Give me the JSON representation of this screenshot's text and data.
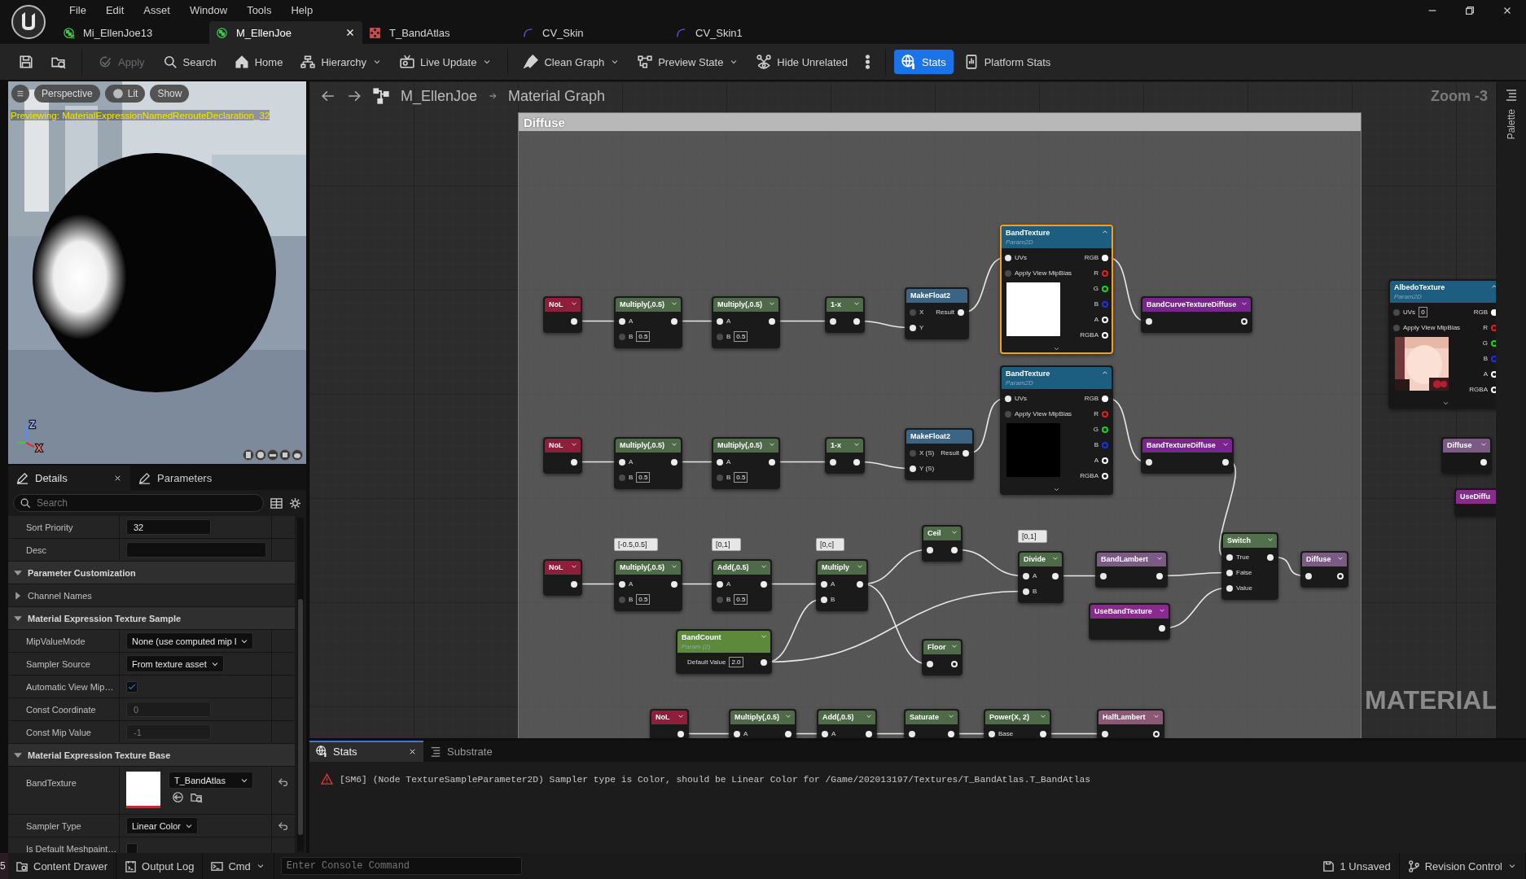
{
  "window": {
    "menu": [
      "File",
      "Edit",
      "Asset",
      "Window",
      "Tools",
      "Help"
    ],
    "tabs": [
      {
        "label": "Mi_EllenJoe13",
        "selected": false,
        "closable": false
      },
      {
        "label": "M_EllenJoe",
        "selected": true,
        "closable": true
      },
      {
        "label": "T_BandAtlas",
        "selected": false,
        "closable": false
      },
      {
        "label": "CV_Skin",
        "selected": false,
        "closable": false
      },
      {
        "label": "CV_Skin1",
        "selected": false,
        "closable": false
      }
    ]
  },
  "toolbar": [
    {
      "kind": "button",
      "disabled": false,
      "dropdown": false,
      "active": false
    },
    {
      "kind": "button",
      "disabled": false,
      "dropdown": false,
      "active": false
    },
    {
      "kind": "separator"
    },
    {
      "kind": "button",
      "label": "Apply",
      "disabled": true,
      "dropdown": false,
      "active": false
    },
    {
      "kind": "button",
      "label": "Search",
      "disabled": false,
      "dropdown": false,
      "active": false
    },
    {
      "kind": "button",
      "label": "Home",
      "disabled": false,
      "dropdown": false,
      "active": false
    },
    {
      "kind": "button",
      "label": "Hierarchy",
      "disabled": false,
      "dropdown": true,
      "active": false
    },
    {
      "kind": "button",
      "label": "Live Update",
      "disabled": false,
      "dropdown": true,
      "active": false
    },
    {
      "kind": "separator"
    },
    {
      "kind": "button",
      "label": "Clean Graph",
      "disabled": false,
      "dropdown": true,
      "active": false
    },
    {
      "kind": "button",
      "label": "Preview State",
      "disabled": false,
      "dropdown": true,
      "active": false
    },
    {
      "kind": "button",
      "label": "Hide Unrelated",
      "disabled": false,
      "dropdown": false,
      "active": false
    },
    {
      "kind": "button",
      "disabled": false,
      "dropdown": false,
      "active": false
    },
    {
      "kind": "separator"
    },
    {
      "kind": "button",
      "label": "Stats",
      "disabled": false,
      "dropdown": false,
      "active": true
    },
    {
      "kind": "button",
      "label": "Platform Stats",
      "disabled": false,
      "dropdown": false,
      "active": false
    }
  ],
  "viewport": {
    "buttons": [
      {
        "kind": "menu"
      },
      {
        "kind": "pill",
        "label": "Perspective"
      },
      {
        "kind": "lit",
        "label": "Lit"
      },
      {
        "kind": "pill",
        "label": "Show"
      }
    ],
    "preview_text": "Previewing: MaterialExpressionNamedRerouteDeclaration_32",
    "axes": [
      "Z",
      "X"
    ]
  },
  "details": {
    "tabs": [
      {
        "label": "Details",
        "selected": true,
        "closable": true
      },
      {
        "label": "Parameters",
        "selected": false,
        "closable": false
      }
    ],
    "search": {
      "placeholder": "Search"
    },
    "rows": [
      {
        "kind": "text",
        "label": "Sort Priority",
        "value": "32",
        "disabled": false
      },
      {
        "kind": "textarea",
        "label": "Desc",
        "disabled": false
      },
      {
        "kind": "section",
        "label": "Parameter Customization",
        "expanded": true
      },
      {
        "kind": "group",
        "label": "Channel Names",
        "expanded": false
      },
      {
        "kind": "section",
        "label": "Material Expression Texture Sample",
        "expanded": true
      },
      {
        "kind": "dropdown",
        "label": "MipValueMode",
        "value": "None (use computed mip l",
        "reset": false
      },
      {
        "kind": "dropdown",
        "label": "Sampler Source",
        "value": "From texture asset",
        "reset": false
      },
      {
        "kind": "checkbox",
        "label": "Automatic View Mip…",
        "checked": true
      },
      {
        "kind": "text",
        "label": "Const Coordinate",
        "value": "0",
        "disabled": true
      },
      {
        "kind": "text",
        "label": "Const Mip Value",
        "value": "-1",
        "disabled": true
      },
      {
        "kind": "section",
        "label": "Material Expression Texture Base",
        "expanded": true
      },
      {
        "kind": "asset",
        "label": "BandTexture",
        "value": "T_BandAtlas",
        "reset": true
      },
      {
        "kind": "dropdown",
        "label": "Sampler Type",
        "value": "Linear Color",
        "reset": true
      },
      {
        "kind": "checkbox",
        "label": "Is Default Meshpaint…",
        "checked": false
      }
    ]
  },
  "graph": {
    "breadcrumb": [
      "M_EllenJoe",
      "Material Graph"
    ],
    "zoom": "Zoom -3",
    "palette": "Palette",
    "watermark": "MATERIAL",
    "comment": {
      "title": "Diffuse"
    },
    "nodes": [
      {
        "kind": "reroute",
        "title": "NoL",
        "color": "#8e1f3b",
        "selected": false,
        "outputs": [
          {
            "connected": true
          }
        ]
      },
      {
        "kind": "math",
        "title": "Multiply(,0.5)",
        "color": "#4e6a48",
        "selected": false,
        "inputs": [
          {
            "label": "A",
            "connected": true
          },
          {
            "label": "B",
            "value": "0.5",
            "connected": false
          }
        ],
        "outputs": [
          {
            "connected": true
          }
        ]
      },
      {
        "kind": "math",
        "title": "Multiply(,0.5)",
        "color": "#4e6a48",
        "selected": false,
        "inputs": [
          {
            "label": "A",
            "connected": true
          },
          {
            "label": "B",
            "value": "0.5",
            "connected": false
          }
        ],
        "outputs": [
          {
            "connected": true
          }
        ]
      },
      {
        "kind": "math",
        "title": "1-x",
        "color": "#4e6a48",
        "selected": false,
        "inputs": [
          {
            "connected": true
          }
        ],
        "outputs": [
          {
            "connected": true
          }
        ]
      },
      {
        "kind": "make",
        "title": "MakeFloat2",
        "color": "#3c6585",
        "selected": false,
        "inputs": [
          {
            "label": "X",
            "connected": false
          },
          {
            "label": "Y",
            "connected": true
          }
        ],
        "outputs": [
          {
            "label": "Result",
            "connected": true
          }
        ]
      },
      {
        "kind": "texture",
        "title": "BandTexture",
        "subtitle": "Param2D",
        "color": "#1c5d80",
        "selected": true,
        "preview": {
          "kind": "swatch",
          "color": "#ffffff"
        },
        "inputs": [
          {
            "label": "UVs",
            "connected": true
          },
          {
            "label": "Apply View MipBias",
            "connected": false
          }
        ],
        "outputs": [
          {
            "label": "RGB",
            "connected": true,
            "color": "#ffffff"
          },
          {
            "label": "R",
            "connected": false,
            "color": "#e02020"
          },
          {
            "label": "G",
            "connected": false,
            "color": "#20d020"
          },
          {
            "label": "B",
            "connected": false,
            "color": "#2030e0"
          },
          {
            "label": "A",
            "connected": false,
            "color": "#ffffff"
          },
          {
            "label": "RGBA",
            "connected": false,
            "color": "#ffffff"
          }
        ]
      },
      {
        "kind": "reroute",
        "title": "BandCurveTextureDiffuse",
        "color": "#7a2490",
        "selected": false,
        "inputs": [
          {
            "connected": true
          }
        ],
        "outputs": [
          {
            "connected": false
          }
        ]
      },
      {
        "kind": "texture",
        "title": "AlbedoTexture",
        "subtitle": "Param2D",
        "color": "#1c5d80",
        "selected": false,
        "preview": {
          "kind": "picture"
        },
        "inputs": [
          {
            "label": "UVs",
            "value": "0",
            "connected": false
          },
          {
            "label": "Apply View MipBias",
            "connected": false
          }
        ],
        "outputs": [
          {
            "label": "RGB",
            "connected": true,
            "color": "#ffffff"
          },
          {
            "label": "R",
            "connected": false,
            "color": "#e02020"
          },
          {
            "label": "G",
            "connected": false,
            "color": "#20d020"
          },
          {
            "label": "B",
            "connected": false,
            "color": "#2030e0"
          },
          {
            "label": "A",
            "connected": false,
            "color": "#ffffff"
          },
          {
            "label": "RGBA",
            "connected": false,
            "color": "#ffffff"
          }
        ]
      },
      {
        "kind": "reroute",
        "title": "NoL",
        "color": "#8e1f3b",
        "selected": false,
        "outputs": [
          {
            "connected": true
          }
        ]
      },
      {
        "kind": "math",
        "title": "Multiply(,0.5)",
        "color": "#4e6a48",
        "selected": false,
        "inputs": [
          {
            "label": "A",
            "connected": true
          },
          {
            "label": "B",
            "value": "0.5",
            "connected": false
          }
        ],
        "outputs": [
          {
            "connected": true
          }
        ]
      },
      {
        "kind": "math",
        "title": "Multiply(,0.5)",
        "color": "#4e6a48",
        "selected": false,
        "inputs": [
          {
            "label": "A",
            "connected": true
          },
          {
            "label": "B",
            "value": "0.5",
            "connected": false
          }
        ],
        "outputs": [
          {
            "connected": true
          }
        ]
      },
      {
        "kind": "math",
        "title": "1-x",
        "color": "#4e6a48",
        "selected": false,
        "inputs": [
          {
            "connected": true
          }
        ],
        "outputs": [
          {
            "connected": true
          }
        ]
      },
      {
        "kind": "make",
        "title": "MakeFloat2",
        "color": "#3c6585",
        "selected": false,
        "inputs": [
          {
            "label": "X (S)",
            "connected": false
          },
          {
            "label": "Y (S)",
            "connected": true
          }
        ],
        "outputs": [
          {
            "label": "Result",
            "connected": true
          }
        ]
      },
      {
        "kind": "texture",
        "title": "BandTexture",
        "subtitle": "Param2D",
        "color": "#1c5d80",
        "selected": false,
        "preview": {
          "kind": "swatch",
          "color": "#000000"
        },
        "inputs": [
          {
            "label": "UVs",
            "connected": true
          },
          {
            "label": "Apply View MipBias",
            "connected": false
          }
        ],
        "outputs": [
          {
            "label": "RGB",
            "connected": true,
            "color": "#ffffff"
          },
          {
            "label": "R",
            "connected": false,
            "color": "#e02020"
          },
          {
            "label": "G",
            "connected": false,
            "color": "#20d020"
          },
          {
            "label": "B",
            "connected": false,
            "color": "#2030e0"
          },
          {
            "label": "A",
            "connected": false,
            "color": "#ffffff"
          },
          {
            "label": "RGBA",
            "connected": false,
            "color": "#ffffff"
          }
        ]
      },
      {
        "kind": "reroute",
        "title": "BandTextureDiffuse",
        "color": "#7a2490",
        "selected": false,
        "inputs": [
          {
            "connected": true
          }
        ],
        "outputs": [
          {
            "connected": true
          }
        ]
      },
      {
        "kind": "reroute",
        "title": "Diffuse",
        "color": "#7c5a86",
        "selected": false,
        "outputs": [
          {
            "connected": true
          }
        ]
      },
      {
        "kind": "reroute",
        "title": "UseDiffu",
        "color": "#8a2a8e",
        "selected": false
      },
      {
        "kind": "reroute",
        "title": "NoL",
        "color": "#8e1f3b",
        "selected": false,
        "outputs": [
          {
            "connected": true
          }
        ]
      },
      {
        "kind": "math",
        "title": "Multiply(,0.5)",
        "comment": "[-0.5,0.5]",
        "color": "#4e6a48",
        "selected": false,
        "inputs": [
          {
            "label": "A",
            "connected": true
          },
          {
            "label": "B",
            "value": "0.5",
            "connected": false
          }
        ],
        "outputs": [
          {
            "connected": true
          }
        ]
      },
      {
        "kind": "math",
        "title": "Add(,0.5)",
        "comment": "[0,1]",
        "color": "#4e6a48",
        "selected": false,
        "inputs": [
          {
            "label": "A",
            "connected": true
          },
          {
            "label": "B",
            "value": "0.5",
            "connected": false
          }
        ],
        "outputs": [
          {
            "connected": true
          }
        ]
      },
      {
        "kind": "math",
        "title": "Multiply",
        "comment": "[0,c]",
        "color": "#4e6a48",
        "selected": false,
        "inputs": [
          {
            "label": "A",
            "connected": true
          },
          {
            "label": "B",
            "connected": true
          }
        ],
        "outputs": [
          {
            "connected": true
          }
        ]
      },
      {
        "kind": "math",
        "title": "Ceil",
        "color": "#4e6a48",
        "selected": false,
        "inputs": [
          {
            "connected": true
          }
        ],
        "outputs": [
          {
            "connected": true
          }
        ]
      },
      {
        "kind": "math",
        "title": "Floor",
        "color": "#4e6a48",
        "selected": false,
        "inputs": [
          {
            "connected": true
          }
        ],
        "outputs": [
          {
            "connected": false
          }
        ]
      },
      {
        "kind": "parameter",
        "title": "BandCount",
        "subtitle": "Param (2)",
        "color": "#5c8a3a",
        "selected": false,
        "fields": [
          {
            "label": "Default Value",
            "value": "2.0"
          }
        ],
        "outputs": [
          {
            "connected": true
          }
        ]
      },
      {
        "kind": "math",
        "title": "Divide",
        "comment": "[0,1]",
        "color": "#4e6a48",
        "selected": false,
        "inputs": [
          {
            "label": "A",
            "connected": true
          },
          {
            "label": "B",
            "connected": true
          }
        ],
        "outputs": [
          {
            "connected": true
          }
        ]
      },
      {
        "kind": "reroute",
        "title": "BandLambert",
        "color": "#7c5a86",
        "selected": false,
        "inputs": [
          {
            "connected": true
          }
        ],
        "outputs": [
          {
            "connected": true
          }
        ]
      },
      {
        "kind": "reroute",
        "title": "UseBandTexture",
        "color": "#8a2a8e",
        "selected": false,
        "outputs": [
          {
            "connected": true
          }
        ]
      },
      {
        "kind": "math",
        "title": "Switch",
        "color": "#53704d",
        "selected": false,
        "inputs": [
          {
            "label": "True",
            "connected": true
          },
          {
            "label": "False",
            "connected": true
          },
          {
            "label": "Value",
            "connected": true
          }
        ],
        "outputs": [
          {
            "connected": true
          }
        ]
      },
      {
        "kind": "reroute",
        "title": "Diffuse",
        "color": "#7c5a86",
        "selected": false,
        "inputs": [
          {
            "connected": true
          }
        ],
        "outputs": [
          {
            "connected": false
          }
        ]
      },
      {
        "kind": "reroute",
        "title": "NoL",
        "color": "#8e1f3b",
        "selected": false,
        "outputs": [
          {
            "connected": true
          }
        ]
      },
      {
        "kind": "math",
        "title": "Multiply(,0.5)",
        "color": "#4e6a48",
        "selected": false,
        "inputs": [
          {
            "label": "A",
            "connected": true
          }
        ],
        "outputs": [
          {
            "connected": true
          }
        ]
      },
      {
        "kind": "math",
        "title": "Add(,0.5)",
        "color": "#4e6a48",
        "selected": false,
        "inputs": [
          {
            "label": "A",
            "connected": true
          }
        ],
        "outputs": [
          {
            "connected": true
          }
        ]
      },
      {
        "kind": "math",
        "title": "Saturate",
        "color": "#4e6a48",
        "selected": false,
        "inputs": [
          {
            "connected": true
          }
        ],
        "outputs": [
          {
            "connected": true
          }
        ]
      },
      {
        "kind": "math",
        "title": "Power(X, 2)",
        "color": "#4e6a48",
        "selected": false,
        "inputs": [
          {
            "label": "Base",
            "connected": true
          }
        ],
        "outputs": [
          {
            "connected": true
          }
        ]
      },
      {
        "kind": "reroute",
        "title": "HalfLambert",
        "color": "#8a5a75",
        "selected": false,
        "inputs": [
          {
            "connected": true
          }
        ],
        "outputs": [
          {
            "connected": false
          }
        ]
      }
    ]
  },
  "stats": {
    "tabs": [
      {
        "label": "Stats",
        "selected": true,
        "closable": true
      },
      {
        "label": "Substrate",
        "selected": false,
        "closable": false
      }
    ],
    "messages": [
      {
        "kind": "warning",
        "text": "[SM6] (Node TextureSampleParameter2D) Sampler type is Color, should be Linear Color for /Game/202013197/Textures/T_BandAtlas.T_BandAtlas"
      }
    ]
  },
  "status_bar": {
    "edge_text": "5",
    "left": [
      {
        "label": "Content Drawer",
        "dropdown": false
      },
      {
        "label": "Output Log",
        "dropdown": false
      },
      {
        "label": "Cmd",
        "dropdown": true
      }
    ],
    "console": {
      "placeholder": "Enter Console Command"
    },
    "right": [
      {
        "label": "1 Unsaved",
        "dropdown": false
      },
      {
        "label": "Revision Control",
        "dropdown": true
      }
    ]
  }
}
